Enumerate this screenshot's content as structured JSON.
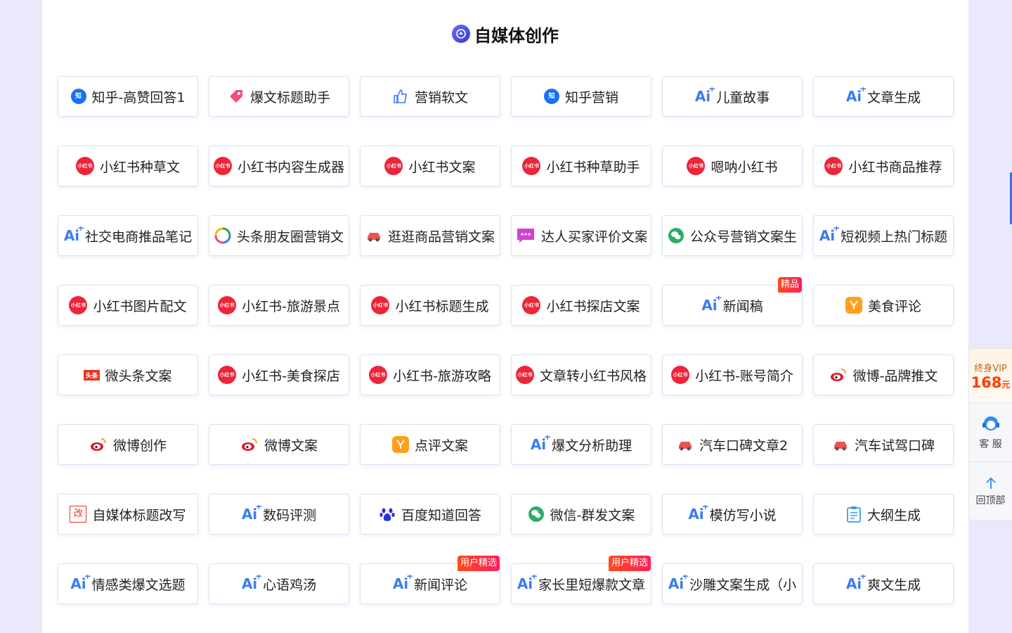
{
  "section": {
    "title": "自媒体创作"
  },
  "cards": [
    {
      "label": "知乎-高赞回答1",
      "icon": "zhihu-icon"
    },
    {
      "label": "爆文标题助手",
      "icon": "tag-icon"
    },
    {
      "label": "营销软文",
      "icon": "like-icon"
    },
    {
      "label": "知乎营销",
      "icon": "zhihu-icon"
    },
    {
      "label": "儿童故事",
      "icon": "ai-icon"
    },
    {
      "label": "文章生成",
      "icon": "ai-icon"
    },
    {
      "label": "小红书种草文",
      "icon": "xiaohongshu-icon"
    },
    {
      "label": "小红书内容生成器",
      "icon": "xiaohongshu-icon"
    },
    {
      "label": "小红书文案",
      "icon": "xiaohongshu-icon"
    },
    {
      "label": "小红书种草助手",
      "icon": "xiaohongshu-icon"
    },
    {
      "label": "嗯呐小红书",
      "icon": "xiaohongshu-icon"
    },
    {
      "label": "小红书商品推荐",
      "icon": "xiaohongshu-icon"
    },
    {
      "label": "社交电商推品笔记",
      "icon": "ai-icon"
    },
    {
      "label": "头条朋友圈营销文",
      "icon": "pinwheel-icon"
    },
    {
      "label": "逛逛商品营销文案",
      "icon": "car-icon"
    },
    {
      "label": "达人买家评价文案",
      "icon": "chat-icon"
    },
    {
      "label": "公众号营销文案生",
      "icon": "wechat-icon"
    },
    {
      "label": "短视频上热门标题",
      "icon": "ai-icon"
    },
    {
      "label": "小红书图片配文",
      "icon": "xiaohongshu-icon"
    },
    {
      "label": "小红书-旅游景点",
      "icon": "xiaohongshu-icon"
    },
    {
      "label": "小红书标题生成",
      "icon": "xiaohongshu-icon"
    },
    {
      "label": "小红书探店文案",
      "icon": "xiaohongshu-icon"
    },
    {
      "label": "新闻稿",
      "icon": "ai-icon",
      "badge": "精品"
    },
    {
      "label": "美食评论",
      "icon": "dianping-icon"
    },
    {
      "label": "微头条文案",
      "icon": "toutiao-icon"
    },
    {
      "label": "小红书-美食探店",
      "icon": "xiaohongshu-icon"
    },
    {
      "label": "小红书-旅游攻略",
      "icon": "xiaohongshu-icon"
    },
    {
      "label": "文章转小红书风格",
      "icon": "xiaohongshu-icon"
    },
    {
      "label": "小红书-账号简介",
      "icon": "xiaohongshu-icon"
    },
    {
      "label": "微博-品牌推文",
      "icon": "weibo-icon"
    },
    {
      "label": "微博创作",
      "icon": "weibo-icon"
    },
    {
      "label": "微博文案",
      "icon": "weibo-icon"
    },
    {
      "label": "点评文案",
      "icon": "dianping-icon"
    },
    {
      "label": "爆文分析助理",
      "icon": "ai-icon"
    },
    {
      "label": "汽车口碑文章2",
      "icon": "car-icon"
    },
    {
      "label": "汽车试驾口碑",
      "icon": "car-icon"
    },
    {
      "label": "自媒体标题改写",
      "icon": "rewrite-icon"
    },
    {
      "label": "数码评测",
      "icon": "ai-icon"
    },
    {
      "label": "百度知道回答",
      "icon": "baidu-icon"
    },
    {
      "label": "微信-群发文案",
      "icon": "wechat-icon"
    },
    {
      "label": "模仿写小说",
      "icon": "ai-icon"
    },
    {
      "label": "大纲生成",
      "icon": "clipboard-icon"
    },
    {
      "label": "情感类爆文选题",
      "icon": "ai-icon"
    },
    {
      "label": "心语鸡汤",
      "icon": "ai-icon"
    },
    {
      "label": "新闻评论",
      "icon": "ai-icon",
      "badge": "用户精选"
    },
    {
      "label": "家长里短爆款文章",
      "icon": "ai-icon",
      "badge": "用户精选"
    },
    {
      "label": "沙雕文案生成（小",
      "icon": "ai-icon"
    },
    {
      "label": "爽文生成",
      "icon": "ai-icon"
    }
  ],
  "icon_text": {
    "ai": "Ai",
    "zhihu": "知",
    "xiaohongshu": "小红书",
    "toutiao": "头条",
    "rewrite": "改"
  },
  "sidebar": {
    "vip_label": "终身VIP",
    "vip_price": "168",
    "vip_unit": "元",
    "service_label": "客 服",
    "top_label": "回顶部"
  },
  "colors": {
    "accent": "#3c7cf0",
    "xiaohongshu": "#ee2438",
    "badge": "#ff3a2e",
    "background": "#e9e9fb"
  }
}
